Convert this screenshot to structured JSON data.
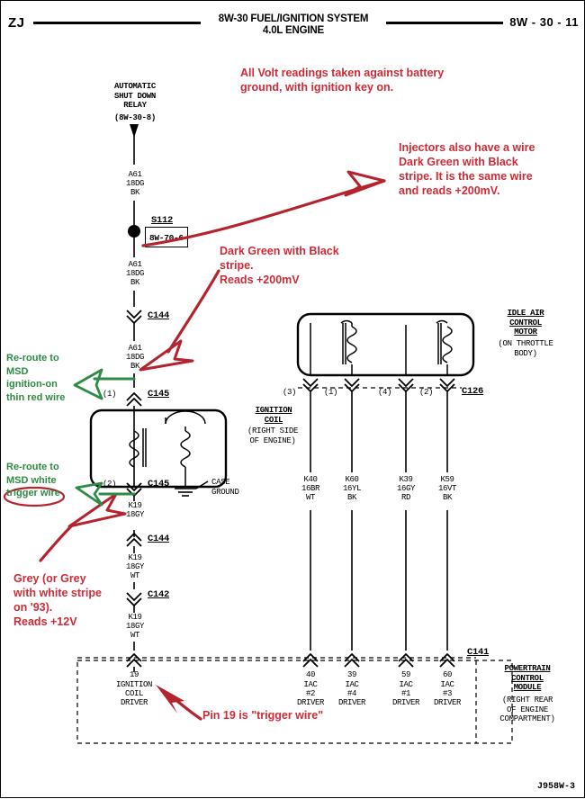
{
  "header": {
    "model": "ZJ",
    "title_line1": "8W-30 FUEL/IGNITION SYSTEM",
    "title_line2": "4.0L ENGINE",
    "page_ref": "8W - 30 - 11"
  },
  "footer": {
    "drawing_code": "J958W-3"
  },
  "annotations": {
    "colors": {
      "red": "#cf2b36",
      "green": "#2e8b43"
    },
    "note_volt": "All Volt readings taken against battery\nground, with ignition key on.",
    "note_injectors": "Injectors also have a wire\nDark Green with Black\nstripe. It is the same wire\nand reads  +200mV.",
    "note_dkgreen": "Dark Green with Black\nstripe.\nReads  +200mV",
    "note_reroute_ign": "Re-route to\nMSD\nignition-on\nthin red wire",
    "note_reroute_trigger": "Re-route to\nMSD white\ntrigger wire",
    "note_trigger_word": "trigger",
    "note_grey": "Grey (or Grey\nwith white stripe\non '93).\nReads +12V",
    "note_pin19": "Pin 19 is \"trigger wire\""
  },
  "components": {
    "asd_relay": {
      "name": "AUTOMATIC\nSHUT DOWN\nRELAY",
      "ref": "(8W-30-8)"
    },
    "splice": {
      "id": "S112",
      "ref": "8W-70-6"
    },
    "ignition_coil": {
      "name": "IGNITION\nCOIL",
      "sub": "(RIGHT SIDE\nOF ENGINE)"
    },
    "case_ground": {
      "label": "CASE\nGROUND"
    },
    "iac_motor": {
      "name": "IDLE AIR\nCONTROL\nMOTOR",
      "sub": "(ON THROTTLE\nBODY)"
    },
    "pcm": {
      "name": "POWERTRAIN\nCONTROL\nMODULE",
      "sub": "(RIGHT REAR\nOF ENGINE\nCOMPARTMENT)"
    }
  },
  "wires": {
    "a61_top": "A61\n18DG\nBK",
    "a61_mid": "A61\n18DG\nBK",
    "a61_low": "A61\n18DG\nBK",
    "k19_top": "K19\n18GY",
    "k19_mid": "K19\n18GY\nWT",
    "k19_low": "K19\n18GY\nWT",
    "iac": [
      {
        "circuit": "K40",
        "gauge": "16BR",
        "color": "WT"
      },
      {
        "circuit": "K60",
        "gauge": "16YL",
        "color": "BK"
      },
      {
        "circuit": "K39",
        "gauge": "16GY",
        "color": "RD"
      },
      {
        "circuit": "K59",
        "gauge": "16VT",
        "color": "BK"
      }
    ]
  },
  "connectors": {
    "c144_upper": "C144",
    "c145_pin1": {
      "pin": "(1)",
      "id": "C145"
    },
    "c145_pin2": {
      "pin": "(2)",
      "id": "C145"
    },
    "c144_lower": "C144",
    "c142": "C142",
    "c126": {
      "id": "C126",
      "pins": [
        "(3)",
        "(1)",
        "(4)",
        "(2)"
      ]
    },
    "c141": "C141"
  },
  "pcm_pins": [
    {
      "num": "19",
      "fn": "IGNITION\nCOIL\nDRIVER"
    },
    {
      "num": "40",
      "fn": "IAC\n#2\nDRIVER"
    },
    {
      "num": "39",
      "fn": "IAC\n#4\nDRIVER"
    },
    {
      "num": "59",
      "fn": "IAC\n#1\nDRIVER"
    },
    {
      "num": "60",
      "fn": "IAC\n#3\nDRIVER"
    }
  ]
}
